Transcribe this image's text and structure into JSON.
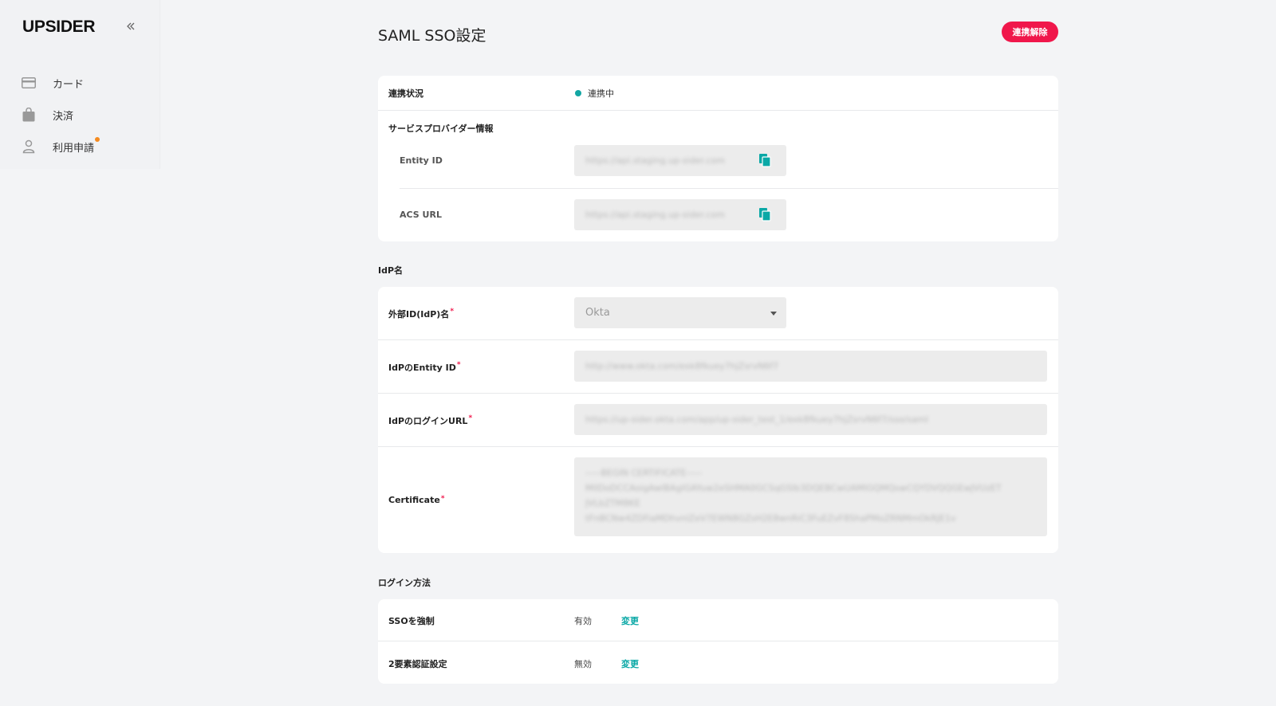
{
  "sidebar": {
    "logo": "UPSIDER",
    "collapse_icon": "chevrons-left-icon",
    "items": [
      {
        "label": "カード",
        "icon": "card-icon"
      },
      {
        "label": "決済",
        "icon": "bag-icon"
      },
      {
        "label": "利用申請",
        "icon": "person-icon",
        "badge": true
      }
    ]
  },
  "header": {
    "title": "SAML SSO設定",
    "disconnect_label": "連携解除"
  },
  "connection": {
    "status_label": "連携状況",
    "status_value": "連携中",
    "sp_section_label": "サービスプロバイダー情報",
    "entity_id_label": "Entity ID",
    "entity_id_value": "https://api.staging.up-sider.com",
    "acs_url_label": "ACS URL",
    "acs_url_value": "https://api.staging.up-sider.com"
  },
  "idp": {
    "section_title": "IdP名",
    "provider_label": "外部ID(IdP)名",
    "provider_value": "Okta",
    "entity_id_label": "IdPのEntity ID",
    "entity_id_value": "http://www.okta.com/exk8fkuey7hjZsrvN6f7",
    "login_url_label": "IdPのログインURL",
    "login_url_value": "https://up-sider.okta.com/app/up-sider_test_1/exk8fkuey7hjZsrvN6f7/sso/saml",
    "certificate_label": "Certificate",
    "certificate_lines": [
      "-----BEGIN CERTIFICATE-----",
      "MIIDoDCCAoigAwIBAgIGAYuw2eSHMA0GCSqGSIb3DQEBCwUAMIGQMQswCQYDVQQGEwJVUzET",
      "JVLbZTM8KE",
      "tFnBCNw4ZDFiaMDhvnlZeV7EWN8GZsH2E8wnRiC3FuEZvF8ShaPMoZRNMmOkRJE1v"
    ]
  },
  "login": {
    "section_title": "ログイン方法",
    "rows": [
      {
        "label": "SSOを強制",
        "value": "有効",
        "action": "変更"
      },
      {
        "label": "2要素認証設定",
        "value": "無効",
        "action": "変更"
      }
    ]
  },
  "colors": {
    "accent": "#0aa8a6",
    "danger": "#f0174b",
    "status_connected": "#12a6a3",
    "background": "#f3f4f6"
  }
}
